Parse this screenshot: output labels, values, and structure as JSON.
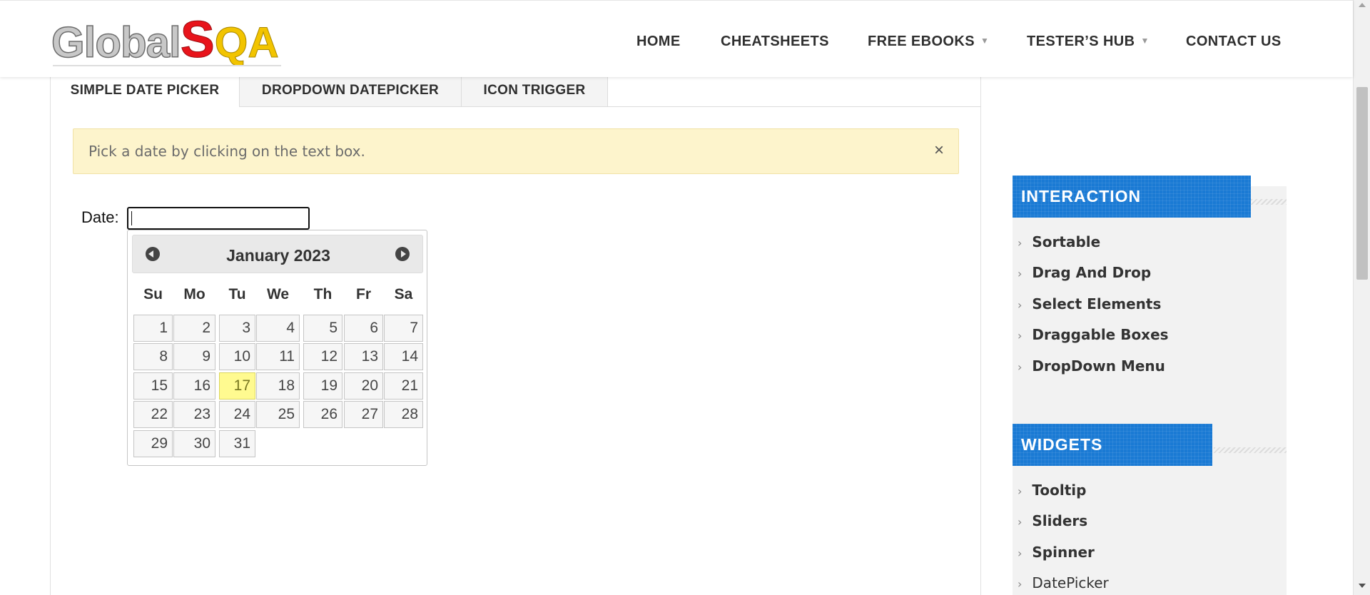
{
  "logo": {
    "part1": "Global",
    "part2": "S",
    "part3": "QA"
  },
  "nav": {
    "home": "HOME",
    "cheatsheets": "CHEATSHEETS",
    "free_ebooks": "FREE EBOOKS",
    "testers_hub": "TESTER’S HUB",
    "contact_us": "CONTACT US"
  },
  "tabs": {
    "simple": "SIMPLE DATE PICKER",
    "dropdown": "DROPDOWN DATEPICKER",
    "icon": "ICON TRIGGER"
  },
  "alert": {
    "text": "Pick a date by clicking on the text box.",
    "close": "×"
  },
  "date_field": {
    "label": "Date:",
    "value": ""
  },
  "datepicker": {
    "month_year": "January 2023",
    "weekdays": [
      "Su",
      "Mo",
      "Tu",
      "We",
      "Th",
      "Fr",
      "Sa"
    ],
    "days": [
      "1",
      "2",
      "3",
      "4",
      "5",
      "6",
      "7",
      "8",
      "9",
      "10",
      "11",
      "12",
      "13",
      "14",
      "15",
      "16",
      "17",
      "18",
      "19",
      "20",
      "21",
      "22",
      "23",
      "24",
      "25",
      "26",
      "27",
      "28",
      "29",
      "30",
      "31"
    ],
    "highlighted": "17"
  },
  "sidebar": {
    "interaction": {
      "title": "INTERACTION",
      "items": [
        "Sortable",
        "Drag And Drop",
        "Select Elements",
        "Draggable Boxes",
        "DropDown Menu"
      ]
    },
    "widgets": {
      "title": "WIDGETS",
      "items": [
        "Tooltip",
        "Sliders",
        "Spinner",
        "DatePicker"
      ]
    }
  },
  "colors": {
    "accent_blue": "#1a7ad4",
    "alert_bg": "#fdf4cc",
    "highlight_day": "#fffa90"
  }
}
